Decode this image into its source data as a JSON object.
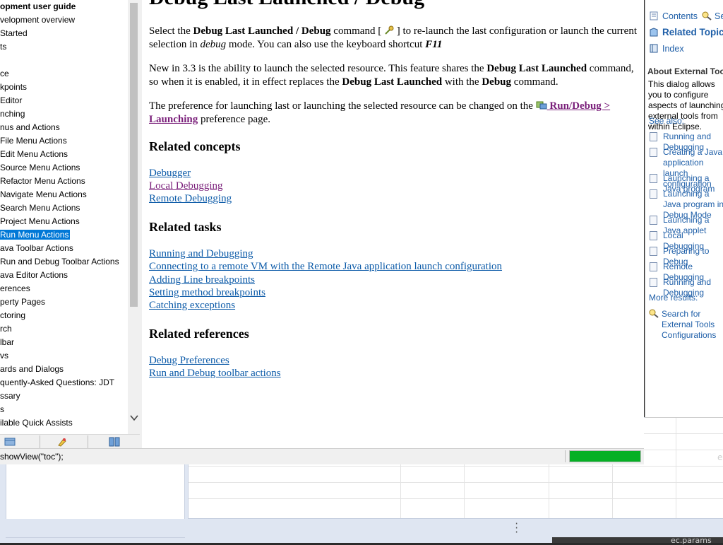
{
  "toc": {
    "items": [
      {
        "label": "opment user guide",
        "bold": true
      },
      {
        "label": "velopment overview"
      },
      {
        "label": "Started"
      },
      {
        "label": "ts"
      },
      {
        "label": ""
      },
      {
        "label": "ce"
      },
      {
        "label": "kpoints"
      },
      {
        "label": "Editor"
      },
      {
        "label": "nching"
      },
      {
        "label": "nus and Actions"
      },
      {
        "label": "File Menu Actions"
      },
      {
        "label": "Edit Menu Actions"
      },
      {
        "label": "Source Menu Actions"
      },
      {
        "label": "Refactor Menu Actions"
      },
      {
        "label": "Navigate Menu Actions"
      },
      {
        "label": "Search Menu Actions"
      },
      {
        "label": "Project Menu Actions"
      },
      {
        "label": "Run Menu Actions",
        "selected": true
      },
      {
        "label": "ava Toolbar Actions"
      },
      {
        "label": "Run and Debug Toolbar Actions"
      },
      {
        "label": "ava Editor Actions"
      },
      {
        "label": "erences"
      },
      {
        "label": "perty Pages"
      },
      {
        "label": "ctoring"
      },
      {
        "label": "rch"
      },
      {
        "label": "lbar"
      },
      {
        "label": "vs"
      },
      {
        "label": "ards and Dialogs"
      },
      {
        "label": "quently-Asked Questions: JDT"
      },
      {
        "label": "ssary"
      },
      {
        "label": "s"
      },
      {
        "label": "ilable Quick Assists"
      }
    ]
  },
  "content": {
    "title": "Debug Last Launched / Debug",
    "p1": {
      "a": "Select the ",
      "b1": "Debug Last Launched",
      "c": " / ",
      "b2": "Debug",
      "d": " command [ ",
      "e": " ] to re-launch the last configuration or launch the current selection in ",
      "em": "debug",
      "f": " mode. You can also use the keyboard shortcut ",
      "shortcut": "F11"
    },
    "p2": {
      "a": "New in 3.3 is the ability to launch the selected resource. This feature shares the ",
      "b1": "Debug Last Launched",
      "c": " command, so when it is enabled, it in effect replaces the ",
      "b2": "Debug Last Launched",
      "d": " with the ",
      "b3": "Debug",
      "e": " command."
    },
    "p3": {
      "a": "The preference for launching last or launching the selected resource can be changed on the ",
      "link": " Run/Debug > Launching",
      "b": " preference page."
    },
    "related_concepts_heading": "Related concepts",
    "related_concepts": [
      "Debugger",
      "Local Debugging",
      "Remote Debugging"
    ],
    "related_tasks_heading": "Related tasks",
    "related_tasks": [
      "Running and Debugging",
      "Connecting to a remote VM with the Remote Java application launch configuration",
      "Adding Line breakpoints",
      "Setting method breakpoints",
      "Catching exceptions"
    ],
    "related_references_heading": "Related references",
    "related_references": [
      "Debug Preferences",
      "Run and Debug toolbar actions"
    ]
  },
  "status": {
    "text": "showView(\"toc\");",
    "progress": 1.0
  },
  "right_panel": {
    "tabs": {
      "contents": "Contents",
      "search": "Se",
      "related": "Related Topics",
      "index": "Index"
    },
    "section_title": "About External Tools",
    "description": "This dialog allows you to configure aspects of launching external tools from within Eclipse.",
    "see_also_label": "See also:",
    "links": [
      "Running and Debugging",
      "Creating a Java application launch configuration",
      "Launching a Java program",
      "Launching a Java program in Debug Mode",
      "Launching a Java applet",
      "Local Debugging",
      "Preparing to Debug",
      "Remote Debugging",
      "Running and Debugging"
    ],
    "more_results_label": "More results:",
    "search_result": "Search for External Tools Configurations"
  },
  "background": {
    "params_text": "ec.params",
    "edge_letter": "e"
  },
  "colors": {
    "selection": "#0078d7",
    "link": "#0b5aa8",
    "visited_link": "#7a1f7a",
    "progress": "#06b025",
    "panel_link": "#1f5fa8"
  }
}
